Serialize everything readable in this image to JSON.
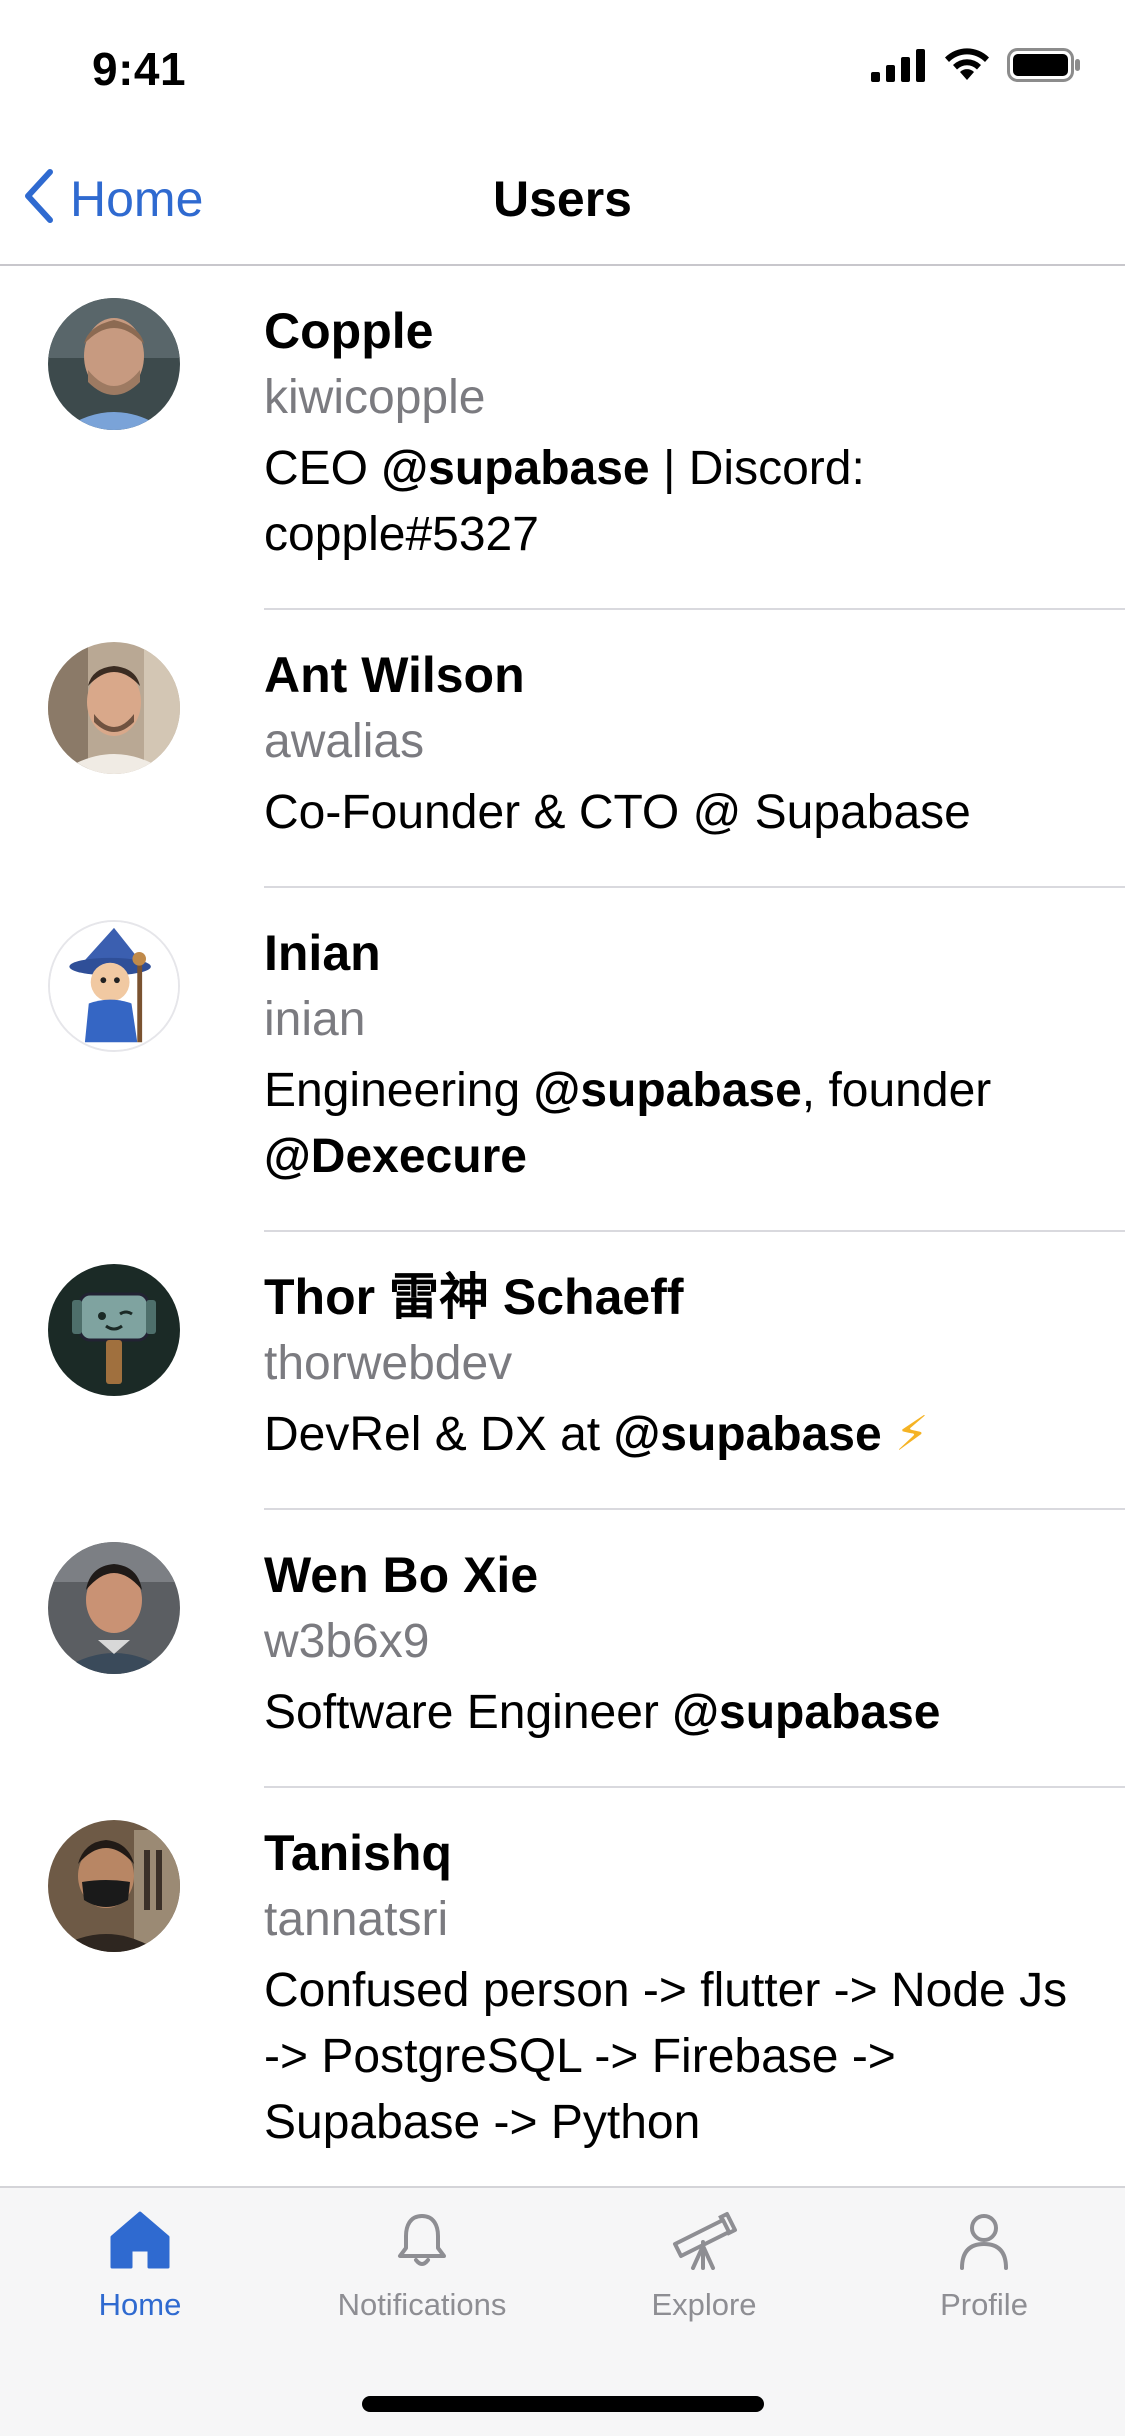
{
  "status_bar": {
    "time": "9:41"
  },
  "nav": {
    "back_label": "Home",
    "title": "Users"
  },
  "users": [
    {
      "name": "Copple",
      "handle": "kiwicopple",
      "bio_parts": [
        "CEO ",
        "@supabase",
        " | Discord: copple#5327"
      ]
    },
    {
      "name": "Ant Wilson",
      "handle": "awalias",
      "bio_parts": [
        "Co-Founder & CTO @ Supabase"
      ]
    },
    {
      "name": "Inian",
      "handle": "inian",
      "bio_parts": [
        "Engineering ",
        "@supabase",
        ", founder ",
        "@Dexecure"
      ]
    },
    {
      "name": "Thor 雷神 Schaeff",
      "handle": "thorwebdev",
      "bio_parts": [
        "DevRel & DX at ",
        "@supabase",
        " ⚡"
      ]
    },
    {
      "name": "Wen Bo Xie",
      "handle": "w3b6x9",
      "bio_parts": [
        "Software Engineer ",
        "@supabase"
      ]
    },
    {
      "name": "Tanishq",
      "handle": "tannatsri",
      "bio_parts": [
        "Confused person -> flutter -> Node Js -> PostgreSQL -> Firebase -> Supabase -> Python"
      ]
    }
  ],
  "tabs": [
    {
      "label": "Home",
      "icon": "home-icon",
      "active": true
    },
    {
      "label": "Notifications",
      "icon": "bell-icon",
      "active": false
    },
    {
      "label": "Explore",
      "icon": "telescope-icon",
      "active": false
    },
    {
      "label": "Profile",
      "icon": "person-icon",
      "active": false
    }
  ],
  "colors": {
    "accent": "#2f6ad0",
    "inactive": "#8e8e93",
    "bolt": "#f5b324"
  }
}
